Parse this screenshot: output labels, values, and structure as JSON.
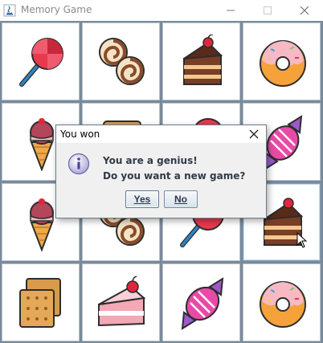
{
  "window": {
    "title": "Memory Game",
    "controls": [
      "minimize-icon",
      "maximize-icon",
      "close-icon"
    ]
  },
  "board": {
    "rows": 4,
    "columns": 4,
    "tiles": [
      [
        "lollipop",
        "swirl-candies",
        "cake-slice",
        "donut"
      ],
      [
        "ice-cream-cone",
        "biscuit",
        "lollipop",
        "wrapped-candy"
      ],
      [
        "ice-cream-cone",
        "swirl-candies",
        "lollipop",
        "cake-slice"
      ],
      [
        "biscuit",
        "strawberry-cake-slice",
        "wrapped-candy",
        "donut"
      ]
    ]
  },
  "dialog": {
    "title": "You won",
    "icon": "info-icon",
    "message_line1": "You are a genius!",
    "message_line2": "Do you want a new game?",
    "yes_label": "Yes",
    "no_label": "No"
  },
  "colors": {
    "grid_line": "#7a8a99",
    "dialog_bg": "#f0f0f0",
    "dialog_text": "#303a47"
  }
}
